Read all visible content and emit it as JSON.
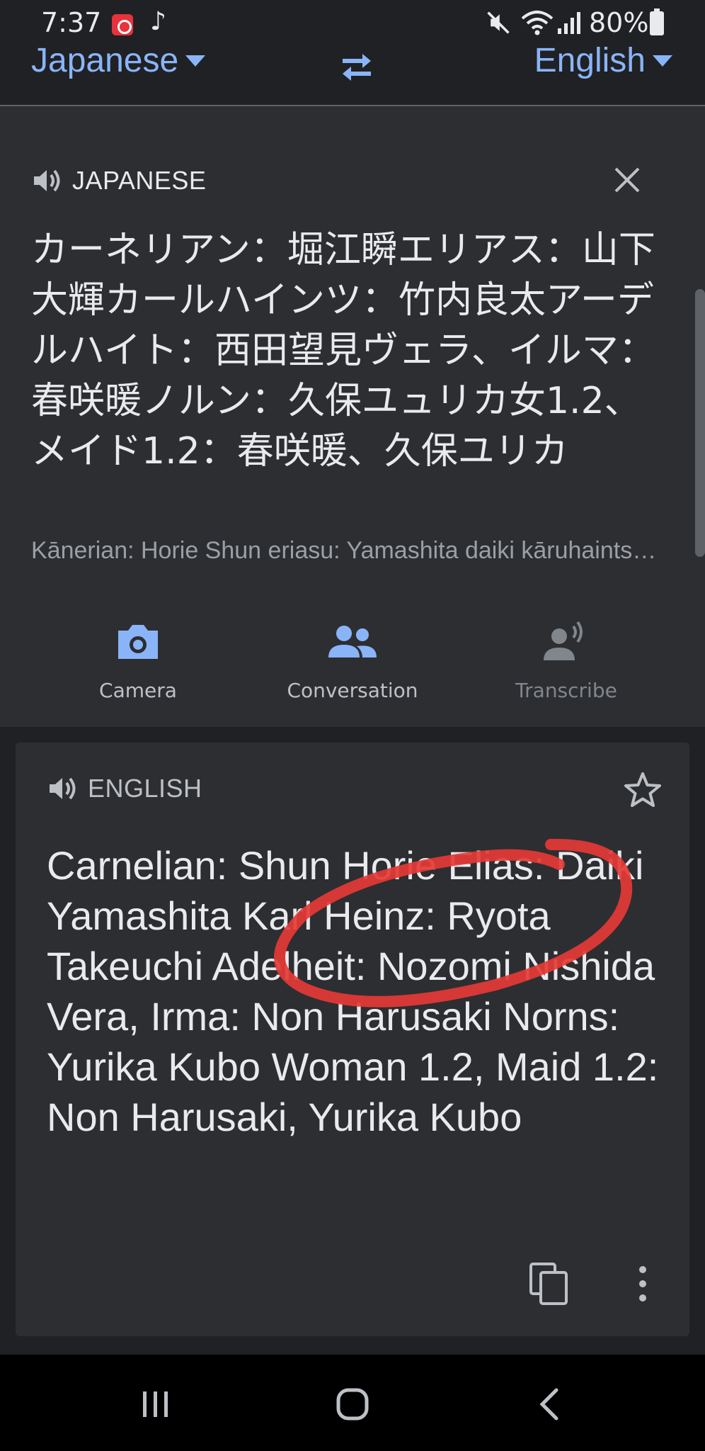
{
  "status_bar": {
    "time": "7:37",
    "battery": "80%",
    "icons": [
      "app-notification-icon",
      "music-note-icon",
      "mute-icon",
      "wifi-icon",
      "signal-icon",
      "battery-icon"
    ]
  },
  "language_bar": {
    "source_language": "Japanese",
    "target_language": "English",
    "swap_icon": "swap-arrows-icon"
  },
  "source": {
    "label": "JAPANESE",
    "text": "カーネリアン：堀江瞬エリアス：山下大輝カールハインツ：竹内良太アーデルハイト：西田望見ヴェラ、イルマ：春咲暖ノルン：久保ユュリカ女1.2、メイド1.2：春咲暖、久保ユリカ",
    "romanization": "Kānerian: Horie Shun eriasu: Yamashita daiki kāruhaintsu: Takeuchi Ryōta",
    "tools": [
      {
        "label": "Camera",
        "icon": "camera-icon"
      },
      {
        "label": "Conversation",
        "icon": "conversation-icon"
      },
      {
        "label": "Transcribe",
        "icon": "transcribe-icon"
      }
    ]
  },
  "translation": {
    "label": "ENGLISH",
    "text": "Carnelian: Shun Horie Elias: Daiki Yamashita Karl Heinz: Ryota Takeuchi Adelheit: Nozomi Nishida Vera, Irma: Non Harusaki Norns: Yurika Kubo Woman 1.2, Maid 1.2: Non Harusaki, Yurika Kubo"
  },
  "colors": {
    "accent": "#8ab4f8",
    "background": "#202124",
    "panel": "#2d2e31",
    "annotation": "#e53935"
  }
}
